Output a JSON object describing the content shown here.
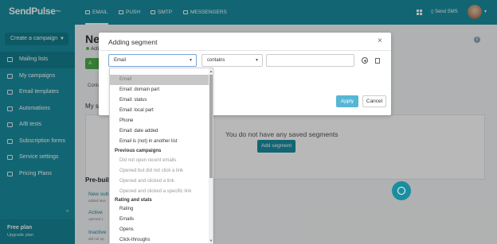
{
  "brand": {
    "logo": "SendPulse",
    "logo_mark": "~"
  },
  "sidebar": {
    "create_button": "Create a campaign",
    "items": [
      {
        "label": "Mailing lists",
        "active": true
      },
      {
        "label": "My campaigns"
      },
      {
        "label": "Email templates"
      },
      {
        "label": "Automations"
      },
      {
        "label": "A/B tests"
      },
      {
        "label": "Subscription forms"
      },
      {
        "label": "Service settings"
      },
      {
        "label": "Pricing Plans"
      }
    ],
    "plan": "Free plan",
    "upgrade": "Upgrade plan"
  },
  "topbar": {
    "tabs": [
      {
        "label": "EMAIL",
        "icon": "envelope-icon",
        "active": true
      },
      {
        "label": "PUSH",
        "icon": "bell-icon"
      },
      {
        "label": "SMTP",
        "icon": "cloud-icon"
      },
      {
        "label": "MESSENGERS",
        "icon": "chat-icon"
      }
    ],
    "send_sms": "Send SMS"
  },
  "page": {
    "title": "New",
    "status": "Activ",
    "green_button": "A",
    "contacts_tab": "Conta",
    "my_segments": "My se",
    "no_segments": "You do not have any saved segments",
    "add_segment": "Add segment",
    "prebuilt": "Pre-buil",
    "prebuilt_items": [
      {
        "label": "New sub",
        "sub": "added less"
      },
      {
        "label": "Active",
        "sub": "opened 1"
      },
      {
        "label": "Inactive",
        "sub": "did not op"
      }
    ]
  },
  "modal": {
    "title": "Adding segment",
    "field_select": "Email",
    "operator_select": "contains",
    "value": "",
    "apply": "Apply",
    "cancel": "Cancel"
  },
  "dropdown": {
    "items": [
      {
        "label": "Email",
        "selected": true
      },
      {
        "label": "Email: domain part"
      },
      {
        "label": "Email: status"
      },
      {
        "label": "Email: local part"
      },
      {
        "label": "Phone"
      },
      {
        "label": "Email: date added"
      },
      {
        "label": "Email is (not) in another list"
      },
      {
        "group": "Previous campaigns"
      },
      {
        "label": "Did not open recent emails",
        "disabled": true
      },
      {
        "label": "Opened but did not click a link",
        "disabled": true
      },
      {
        "label": "Opened and clicked a link",
        "disabled": true
      },
      {
        "label": "Opened and clicked a specific link",
        "disabled": true
      },
      {
        "group": "Rating and stats"
      },
      {
        "label": "Rating"
      },
      {
        "label": "Emails"
      },
      {
        "label": "Opens"
      },
      {
        "label": "Click-throughs"
      }
    ]
  }
}
